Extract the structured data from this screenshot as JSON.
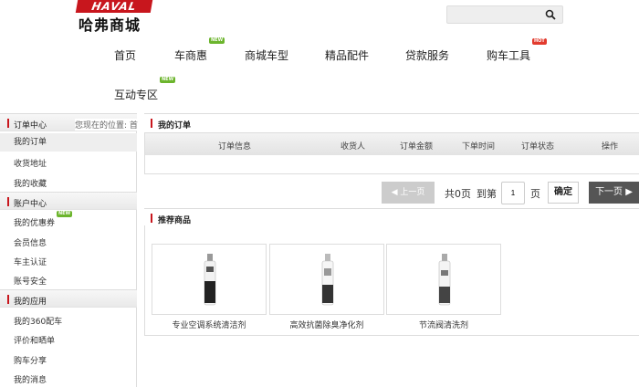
{
  "header": {
    "logo_brand": "HAVAL",
    "logo_cn": "哈弗商城",
    "search_placeholder": ""
  },
  "nav": [
    {
      "label": "首页",
      "badge": ""
    },
    {
      "label": "车商惠",
      "badge": "NEW"
    },
    {
      "label": "商城车型",
      "badge": ""
    },
    {
      "label": "精品配件",
      "badge": ""
    },
    {
      "label": "贷款服务",
      "badge": ""
    },
    {
      "label": "购车工具",
      "badge": "HOT"
    },
    {
      "label": "互动专区",
      "badge": "NEW"
    }
  ],
  "breadcrumb": "您现在的位置: 首",
  "sidebar": {
    "sections": [
      {
        "title": "订单中心",
        "items": [
          "我的订单",
          "收货地址",
          "我的收藏"
        ]
      },
      {
        "title": "账户中心",
        "items": [
          "我的优惠券",
          "会员信息",
          "车主认证",
          "账号安全"
        ]
      },
      {
        "title": "我的应用",
        "items": [
          "我的360配车",
          "评价和晒单",
          "购车分享",
          "我的消息"
        ]
      }
    ],
    "coupon_badge": "NEW"
  },
  "orders": {
    "title": "我的订单",
    "columns": [
      "订单信息",
      "收货人",
      "订单金额",
      "下单时间",
      "订单状态",
      "操作"
    ]
  },
  "pagination": {
    "prev": "上一页",
    "total": "共0页",
    "goto": "到第",
    "page_value": "1",
    "page_unit": "页",
    "confirm": "确定",
    "next": "下一页"
  },
  "recommend": {
    "title": "推荐商品",
    "products": [
      {
        "name": "专业空调系统清洁剂",
        "color": "#222"
      },
      {
        "name": "高效抗菌除臭净化剂",
        "color": "#333"
      },
      {
        "name": "节流阀清洗剂",
        "color": "#444"
      }
    ]
  },
  "colors": {
    "accent": "#c8161d",
    "new_badge": "#6cb52d",
    "hot_badge": "#e23b2e"
  }
}
